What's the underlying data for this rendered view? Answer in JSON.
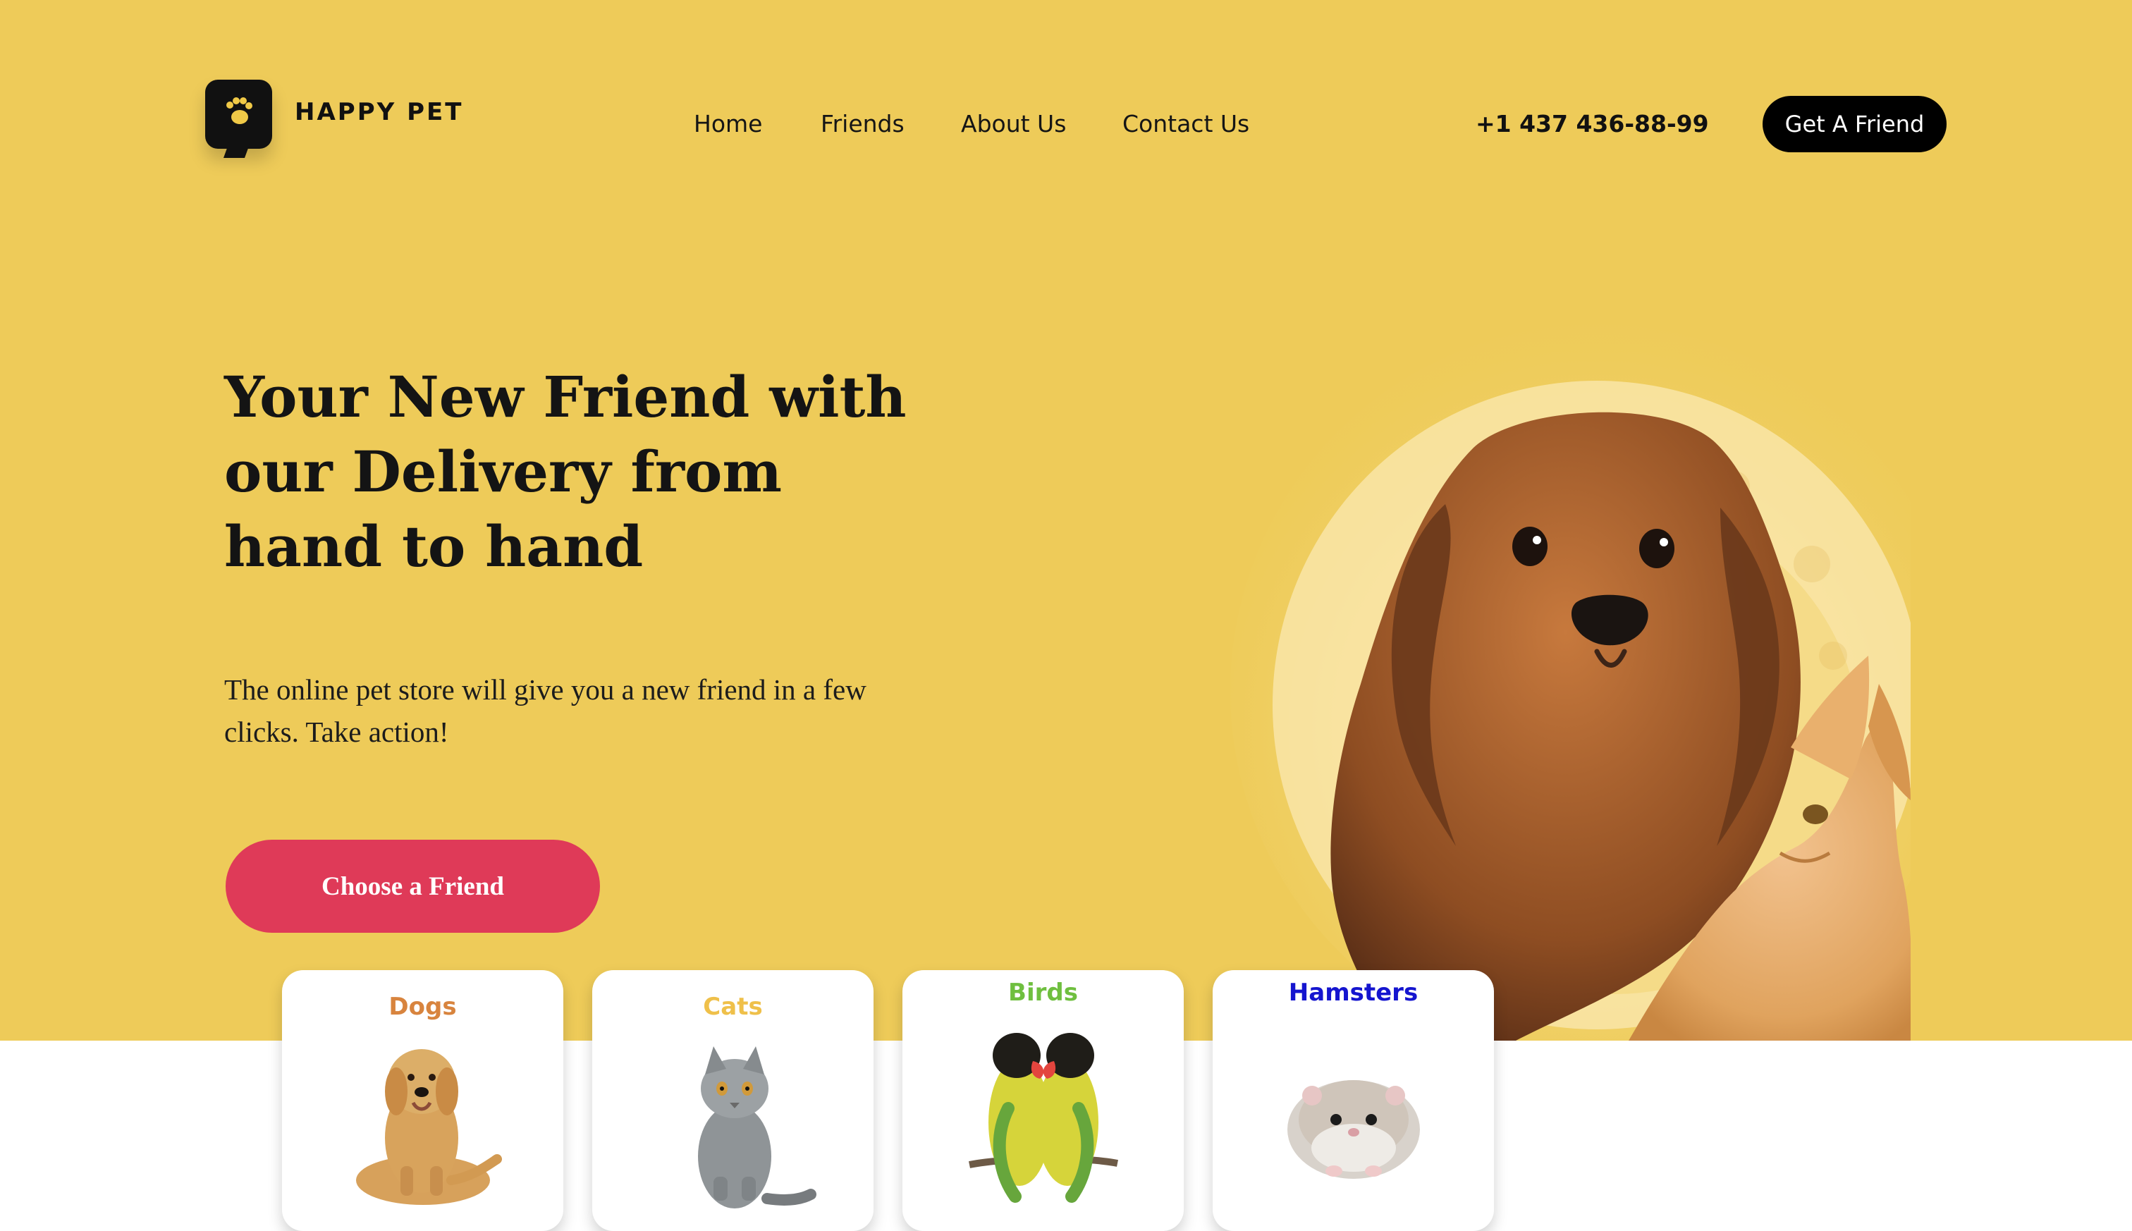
{
  "brand": {
    "name": "HAPPY PET",
    "icon": "paw-chat-icon"
  },
  "nav": {
    "items": [
      {
        "label": "Home"
      },
      {
        "label": "Friends"
      },
      {
        "label": "About Us"
      },
      {
        "label": "Contact Us"
      }
    ]
  },
  "header": {
    "phone": "+1 437 436-88-99",
    "cta_label": "Get A Friend"
  },
  "hero": {
    "title": "Your New Friend with our Delivery from hand to hand",
    "subtitle": "The online pet store will give you a new friend in a few clicks. Take action!",
    "cta_label": "Choose a Friend",
    "image": "dog-and-cat-illustration"
  },
  "categories": [
    {
      "label": "Dogs",
      "color": "#d8843e",
      "image": "dog-photo"
    },
    {
      "label": "Cats",
      "color": "#efc04a",
      "image": "cat-photo"
    },
    {
      "label": "Birds",
      "color": "#6fbf3f",
      "image": "birds-photo"
    },
    {
      "label": "Hamsters",
      "color": "#1515cf",
      "image": "hamster-photo"
    }
  ],
  "colors": {
    "background": "#eecb59",
    "accent": "#df3a58",
    "dark": "#000000"
  }
}
